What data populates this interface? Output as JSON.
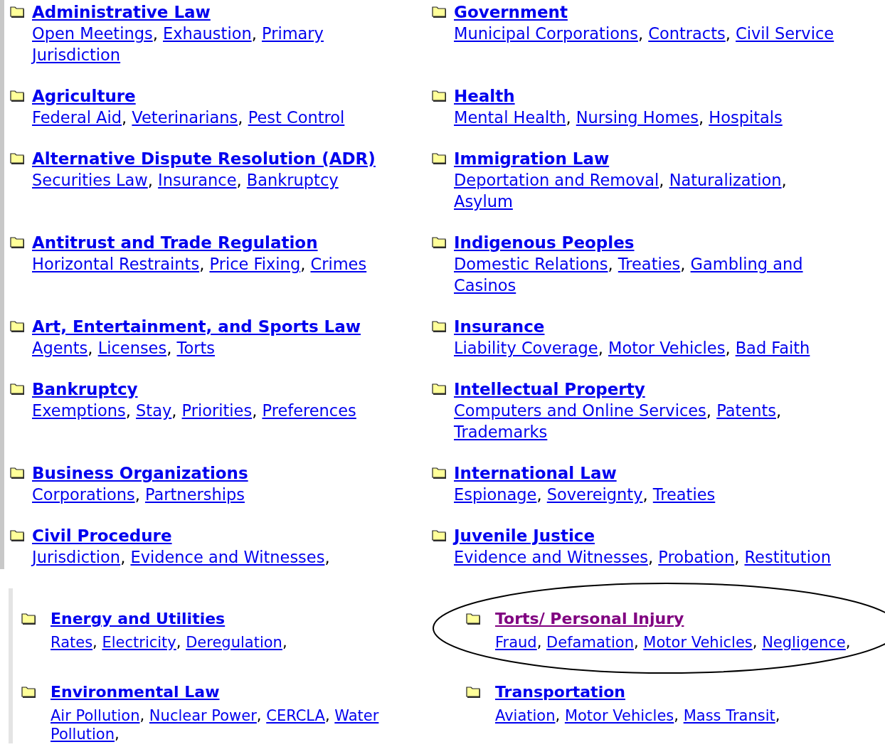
{
  "separator": ",",
  "sections": [
    {
      "categories": [
        {
          "title": "Administrative Law",
          "visited": false,
          "circled": false,
          "links": [
            "Open Meetings",
            "Exhaustion",
            {
              "lines": [
                "Primary",
                "Jurisdiction"
              ]
            }
          ]
        },
        {
          "title": "Government",
          "visited": false,
          "circled": false,
          "links": [
            "Municipal Corporations",
            "Contracts",
            "Civil Service"
          ]
        },
        {
          "title": "Agriculture",
          "visited": false,
          "circled": false,
          "links": [
            "Federal Aid",
            "Veterinarians",
            "Pest Control"
          ]
        },
        {
          "title": "Health",
          "visited": false,
          "circled": false,
          "links": [
            "Mental Health",
            "Nursing Homes",
            "Hospitals"
          ]
        },
        {
          "title": "Alternative Dispute Resolution (ADR)",
          "visited": false,
          "circled": false,
          "links": [
            "Securities Law",
            "Insurance",
            "Bankruptcy"
          ]
        },
        {
          "title": "Immigration Law",
          "visited": false,
          "circled": false,
          "links": [
            "Deportation and Removal",
            "Naturalization",
            "Asylum"
          ]
        },
        {
          "title": "Antitrust and Trade Regulation",
          "visited": false,
          "circled": false,
          "links": [
            "Horizontal Restraints",
            "Price Fixing",
            "Crimes"
          ]
        },
        {
          "title": "Indigenous Peoples",
          "visited": false,
          "circled": false,
          "links": [
            "Domestic Relations",
            "Treaties",
            {
              "lines": [
                "Gambling and",
                "Casinos"
              ]
            }
          ]
        },
        {
          "title": "Art, Entertainment, and Sports Law",
          "visited": false,
          "circled": false,
          "links": [
            "Agents",
            "Licenses",
            "Torts"
          ]
        },
        {
          "title": "Insurance",
          "visited": false,
          "circled": false,
          "links": [
            "Liability Coverage",
            "Motor Vehicles",
            "Bad Faith"
          ]
        },
        {
          "title": "Bankruptcy",
          "visited": false,
          "circled": false,
          "links": [
            "Exemptions",
            "Stay",
            "Priorities",
            "Preferences"
          ]
        },
        {
          "title": "Intellectual Property",
          "visited": false,
          "circled": false,
          "links": [
            "Computers and Online Services",
            "Patents",
            "Trademarks"
          ]
        },
        {
          "title": "Business Organizations",
          "visited": false,
          "circled": false,
          "links": [
            "Corporations",
            "Partnerships"
          ]
        },
        {
          "title": "International Law",
          "visited": false,
          "circled": false,
          "links": [
            "Espionage",
            "Sovereignty",
            "Treaties"
          ]
        },
        {
          "title": "Civil Procedure",
          "visited": false,
          "circled": false,
          "links": [
            "Jurisdiction",
            "Evidence and Witnesses"
          ],
          "trailing": ","
        },
        {
          "title": "Juvenile Justice",
          "visited": false,
          "circled": false,
          "links": [
            "Evidence and Witnesses",
            "Probation",
            "Restitution"
          ]
        }
      ]
    },
    {
      "categories": [
        {
          "title": "Energy and Utilities",
          "visited": false,
          "circled": false,
          "links": [
            "Rates",
            "Electricity",
            "Deregulation"
          ],
          "trailing": ","
        },
        {
          "title": "Torts/ Personal Injury",
          "visited": true,
          "circled": true,
          "links": [
            "Fraud",
            "Defamation",
            "Motor Vehicles",
            "Negligence"
          ],
          "trailing": ","
        },
        {
          "title": "Environmental Law",
          "visited": false,
          "circled": false,
          "links": [
            "Air Pollution",
            "Nuclear Power",
            "CERCLA",
            {
              "lines": [
                "Water",
                "Pollution"
              ]
            }
          ],
          "trailing": ","
        },
        {
          "title": "Transportation",
          "visited": false,
          "circled": false,
          "links": [
            "Aviation",
            "Motor Vehicles",
            "Mass Transit"
          ],
          "trailing": ","
        }
      ]
    }
  ]
}
